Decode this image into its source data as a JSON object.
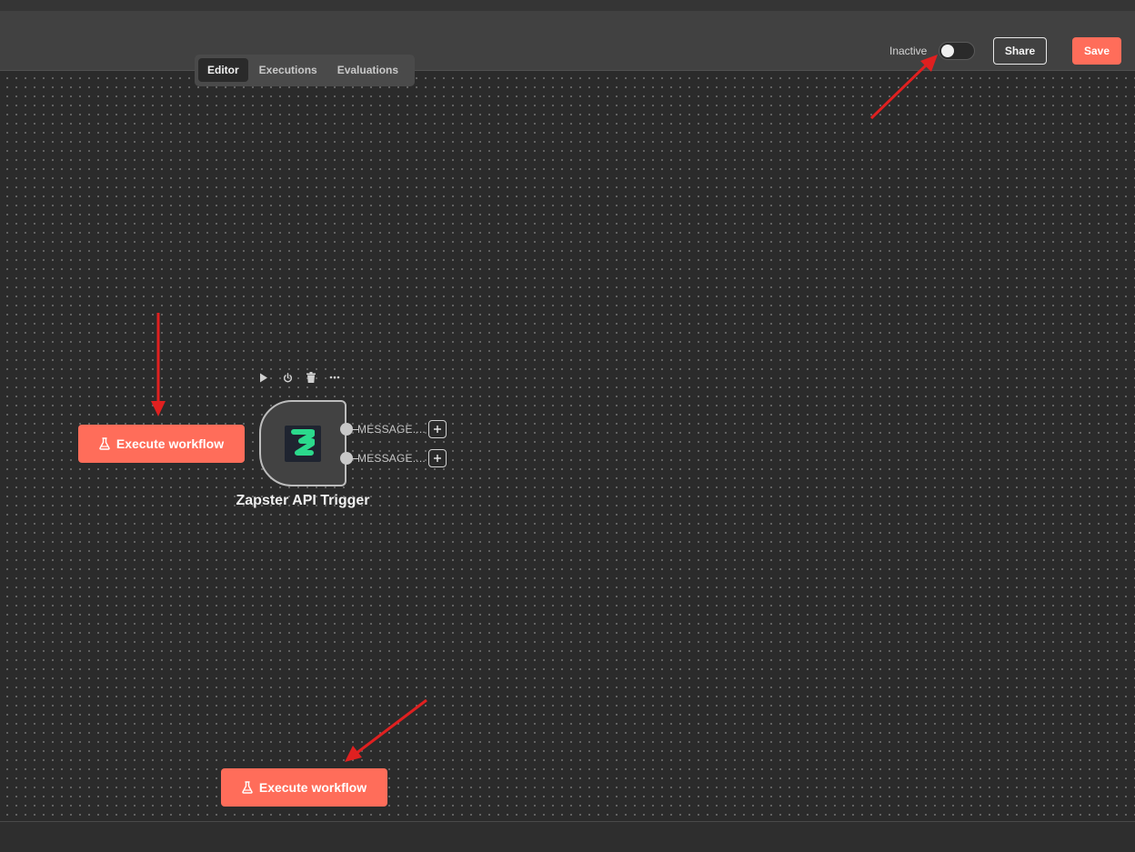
{
  "header": {
    "tabs": [
      {
        "label": "Editor",
        "active": true
      },
      {
        "label": "Executions",
        "active": false
      },
      {
        "label": "Evaluations",
        "active": false
      }
    ],
    "status_label": "Inactive",
    "active": false,
    "share_label": "Share",
    "save_label": "Save"
  },
  "canvas": {
    "execute_buttons": [
      {
        "label": "Execute workflow",
        "icon": "flask-icon"
      },
      {
        "label": "Execute workflow",
        "icon": "flask-icon"
      }
    ],
    "node": {
      "title": "Zapster API Trigger",
      "icon": "zapster-logo",
      "toolbar": [
        "play-icon",
        "power-icon",
        "trash-icon",
        "more-icon"
      ],
      "outputs": [
        {
          "label": "MESSAGE...."
        },
        {
          "label": "MESSAGE...."
        }
      ]
    }
  },
  "colors": {
    "accent": "#ff6d5a",
    "canvas_bg": "#2b2b2b",
    "header_bg": "#414141",
    "annotation_arrow": "#e02020",
    "zapster_green": "#2bd98c"
  }
}
